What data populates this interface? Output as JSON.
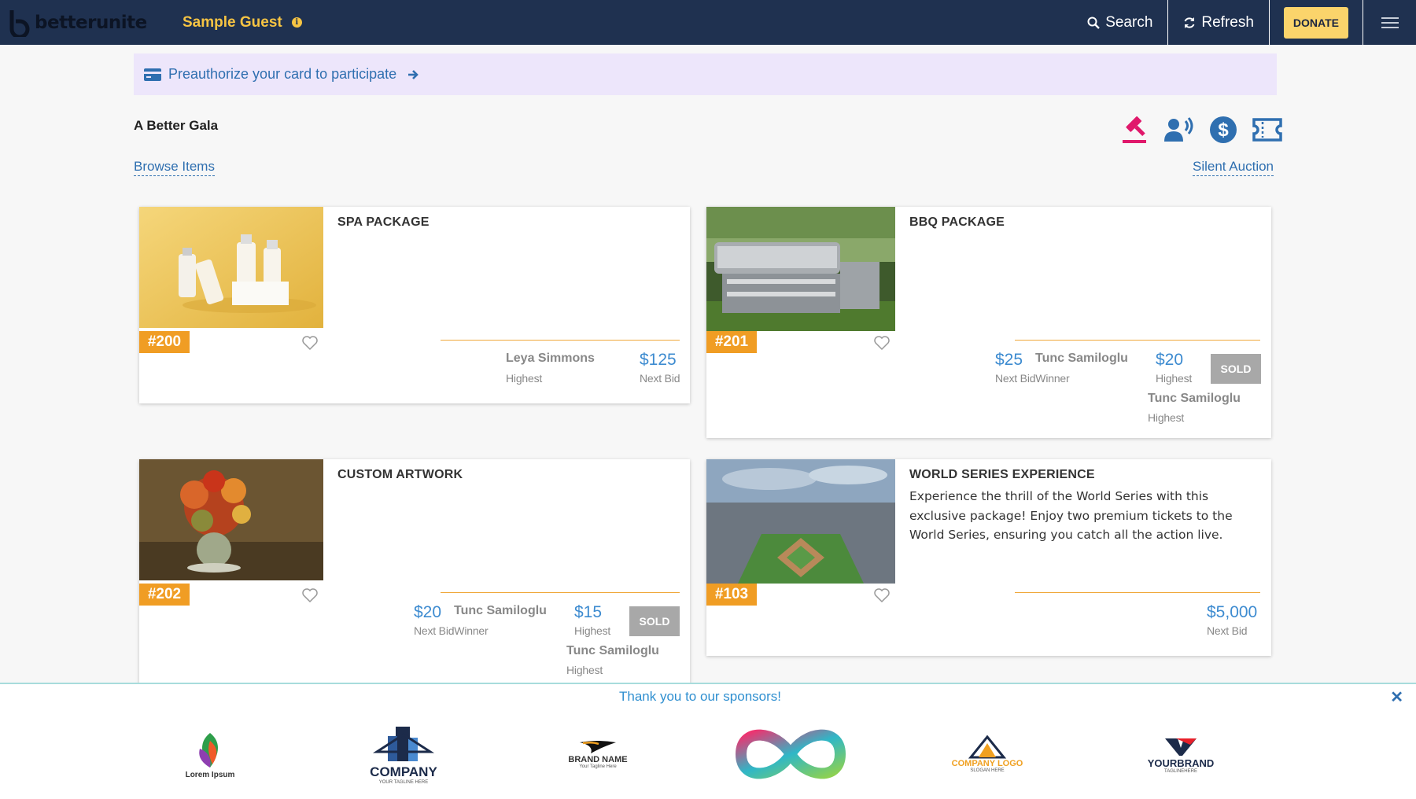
{
  "header": {
    "logo_text_a": "better",
    "logo_text_b": "unite",
    "guest_name": "Sample Guest",
    "search_label": "Search",
    "refresh_label": "Refresh",
    "donate_label": "DONATE"
  },
  "banner": {
    "text": "Preauthorize your card to participate"
  },
  "event": {
    "title": "A Better Gala",
    "browse_link": "Browse Items",
    "auction_link": "Silent Auction",
    "icons": [
      "gavel-icon",
      "speaker-icon",
      "dollar-icon",
      "ticket-icon"
    ]
  },
  "items": [
    {
      "number": "#200",
      "title": "SPA PACKAGE",
      "description": "",
      "bidder": "Leya Simmons",
      "bidder_label": "Highest",
      "next_bid": "$125",
      "next_bid_label": "Next Bid"
    },
    {
      "number": "#201",
      "title": "BBQ PACKAGE",
      "description": "",
      "next_bid": "$25",
      "next_bid_label": "Next BidWinner",
      "winner": "Tunc Samiloglu",
      "highest": "$20",
      "highest_label": "Highest",
      "status": "SOLD",
      "bidder2": "Tunc Samiloglu",
      "bidder2_label": "Highest"
    },
    {
      "number": "#202",
      "title": "CUSTOM ARTWORK",
      "description": "",
      "next_bid": "$20",
      "next_bid_label": "Next BidWinner",
      "winner": "Tunc Samiloglu",
      "highest": "$15",
      "highest_label": "Highest",
      "status": "SOLD",
      "bidder2": "Tunc Samiloglu",
      "bidder2_label": "Highest"
    },
    {
      "number": "#103",
      "title": "WORLD SERIES EXPERIENCE",
      "description": "Experience the thrill of the World Series with this exclusive package! Enjoy two premium tickets to the World Series, ensuring you catch all the action live.",
      "next_bid": "$5,000",
      "next_bid_label": "Next Bid"
    }
  ],
  "sponsors": {
    "title": "Thank you to our sponsors!",
    "close": "✕",
    "logos": [
      {
        "name": "Lorem Ipsum",
        "tag": ""
      },
      {
        "name": "COMPANY",
        "tag": "YOUR TAGLINE HERE"
      },
      {
        "name": "BRAND NAME",
        "tag": "Your Tagline Here"
      },
      {
        "name": "",
        "tag": ""
      },
      {
        "name": "COMPANY LOGO",
        "tag": "SLOGAN HERE"
      },
      {
        "name": "YOURBRAND",
        "tag": "TAGLINEHERE"
      }
    ]
  },
  "colors": {
    "header_bg": "#1f3150",
    "accent_yellow": "#f6c443",
    "badge_orange": "#f09d24",
    "link_blue": "#2f6fb0",
    "amount_blue": "#3d8bd0"
  }
}
